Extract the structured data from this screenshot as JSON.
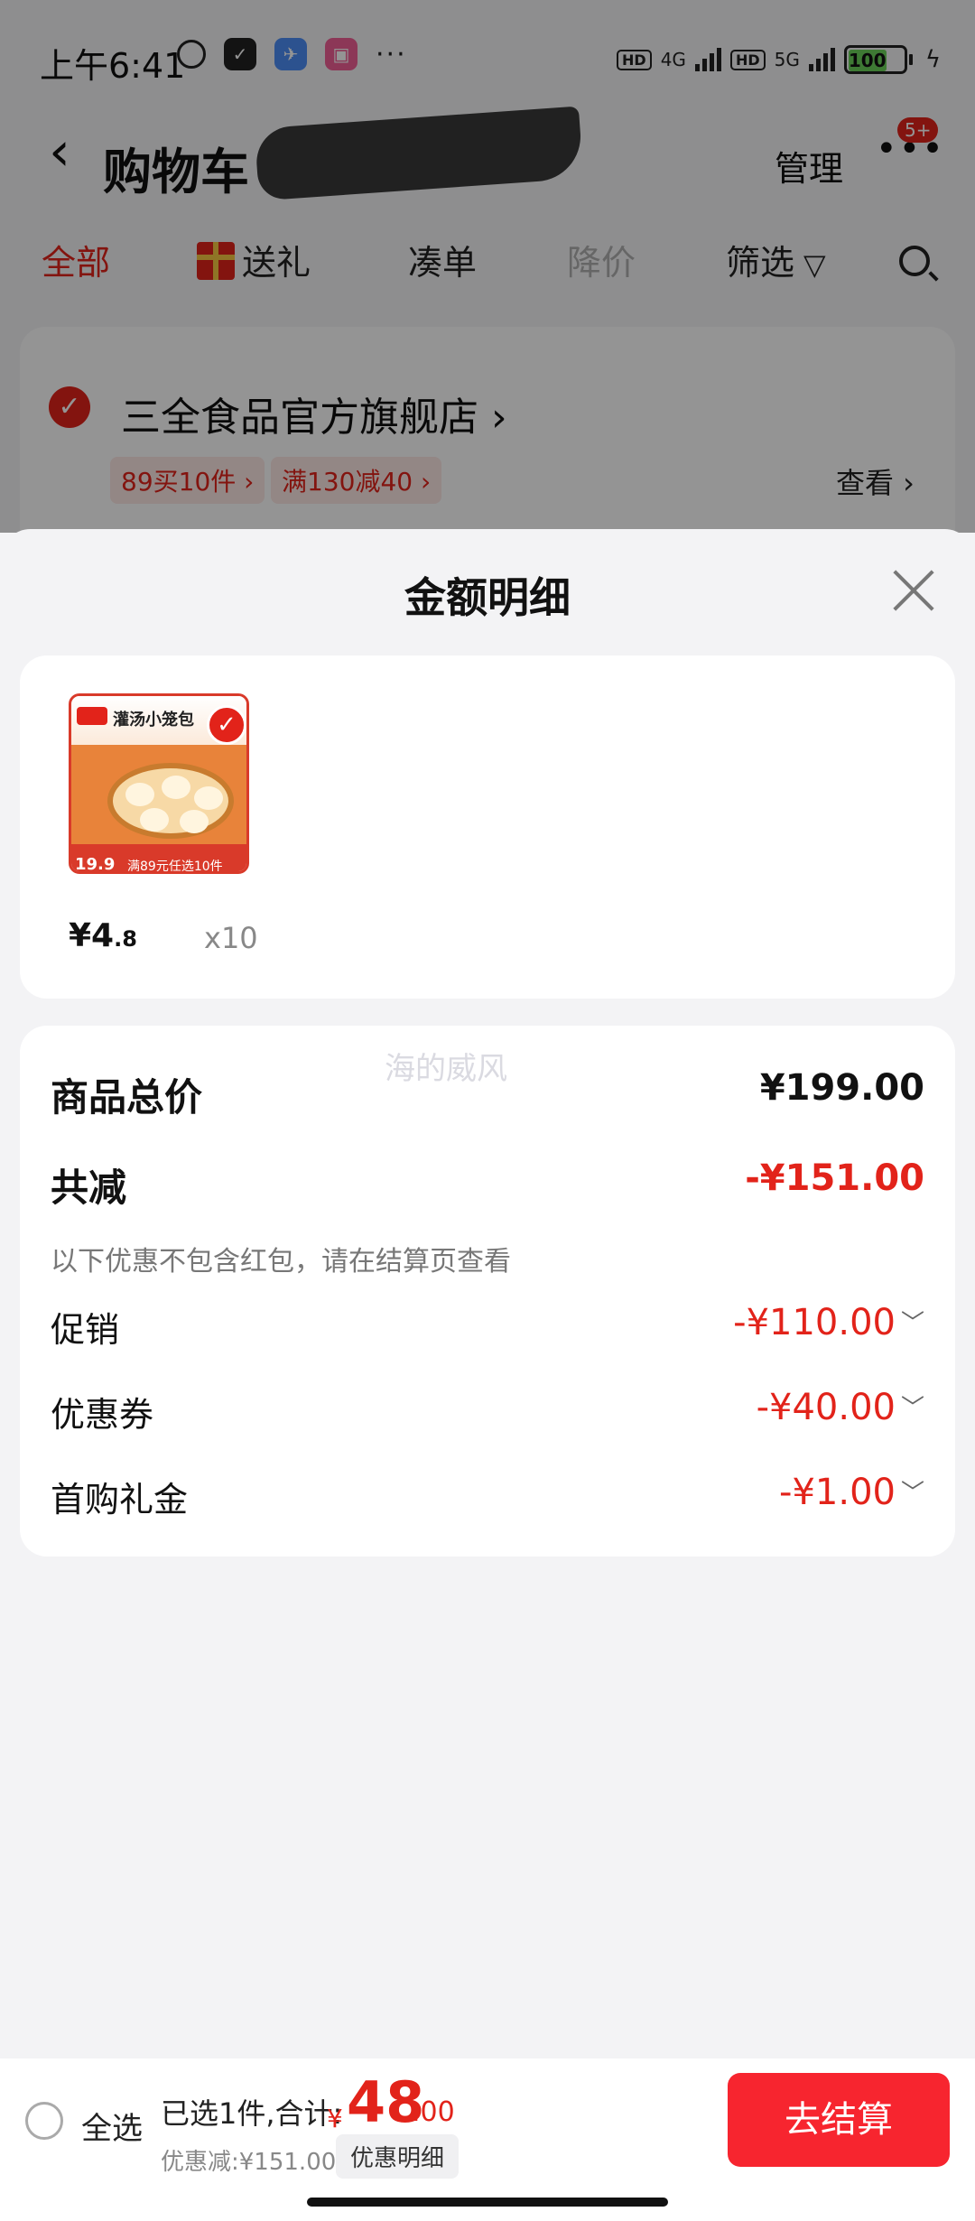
{
  "status_bar": {
    "time": "上午6:41",
    "network_1": "4G",
    "network_2": "5G",
    "battery": "100",
    "hd_label": "HD",
    "more": "···"
  },
  "header": {
    "title": "购物车",
    "manage": "管理",
    "more": "•••",
    "badge": "5+"
  },
  "filter_tabs": [
    {
      "label": "全部"
    },
    {
      "label": "送礼"
    },
    {
      "label": "凑单"
    },
    {
      "label": "降价"
    },
    {
      "label": "筛选"
    }
  ],
  "store": {
    "name": "三全食品官方旗舰店",
    "arrow": "›",
    "tags": [
      "89买10件 ›",
      "满130减40 ›"
    ],
    "view": "查看 ›"
  },
  "sheet": {
    "title": "金额明细",
    "watermark": "海的威风",
    "product": {
      "name_on_image": "灌汤小笼包",
      "image_price": "19.9",
      "image_banner": "满89元任选10件",
      "price_int": "¥4",
      "price_dec": ".8",
      "quantity": "x10"
    },
    "details": {
      "total_label": "商品总价",
      "total_value": "¥199.00",
      "discount_label": "共减",
      "discount_value": "-¥151.00",
      "note": "以下优惠不包含红包，请在结算页查看",
      "items": [
        {
          "label": "促销",
          "value": "-¥110.00"
        },
        {
          "label": "优惠券",
          "value": "-¥40.00"
        },
        {
          "label": "首购礼金",
          "value": "-¥1.00"
        }
      ]
    }
  },
  "bottom_bar": {
    "select_all": "全选",
    "selected_text": "已选1件,合计:",
    "currency": "¥",
    "total_int": "48",
    "total_dec": ".00",
    "saved_text": "优惠减:¥151.00",
    "detail_chip": "优惠明细",
    "checkout": "去结算"
  },
  "colors": {
    "accent": "#e2231a",
    "checkout": "#f7252f"
  }
}
